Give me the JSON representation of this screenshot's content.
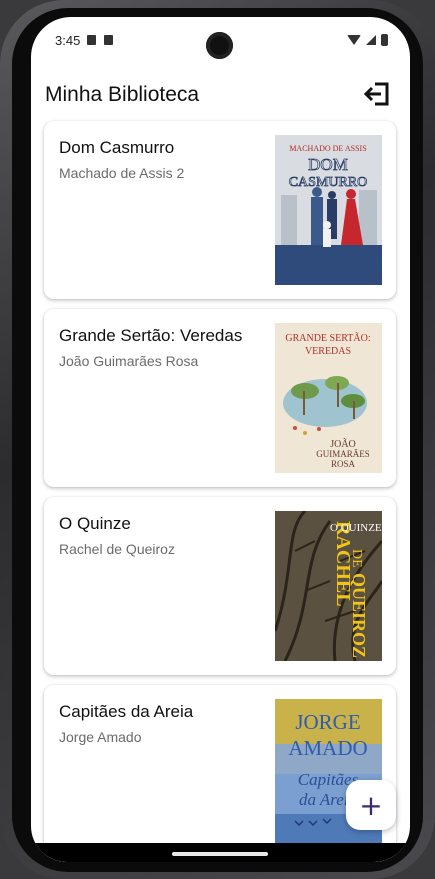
{
  "status": {
    "time": "3:45"
  },
  "appbar": {
    "title": "Minha Biblioteca",
    "logout_icon": "logout-icon"
  },
  "books": [
    {
      "title": "Dom Casmurro",
      "author": "Machado de Assis 2",
      "cover": {
        "line1": "MACHADO DE ASSIS",
        "line2": "DOM",
        "line3": "CASMURRO"
      }
    },
    {
      "title": "Grande Sertão: Veredas",
      "author": "João Guimarães Rosa",
      "cover": {
        "line1": "GRANDE SERTÃO:",
        "line2": "VEREDAS",
        "line3": "JOÃO",
        "line4": "GUIMARÃES",
        "line5": "ROSA"
      }
    },
    {
      "title": "O Quinze",
      "author": "Rachel de Queiroz",
      "cover": {
        "line1": "RACHEL",
        "line2": "DE",
        "line3": "O QUINZE",
        "line4": "QUEIROZ"
      }
    },
    {
      "title": "Capitães da Areia",
      "author": "Jorge Amado",
      "cover": {
        "line1": "JORGE",
        "line2": "AMADO",
        "line3": "Capitães",
        "line4": "da Areia"
      }
    }
  ],
  "fab": {
    "label": "+"
  },
  "colors": {
    "accent": "#3b2a6b"
  }
}
